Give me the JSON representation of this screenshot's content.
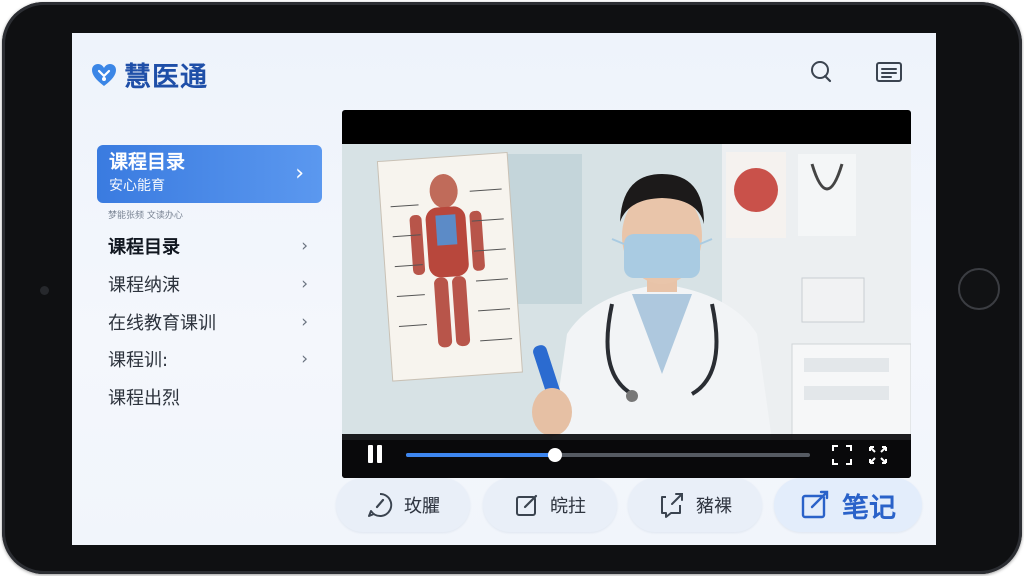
{
  "app": {
    "name": "慧医通",
    "brand_color": "#1f4fa8",
    "accent_color": "#3d86f0"
  },
  "header": {
    "search_icon": "search-icon",
    "menu_icon": "menu-icon"
  },
  "sidebar": {
    "active": {
      "title": "课程目录",
      "subtitle": "安心能育"
    },
    "hint": "梦能张频 文读办心",
    "items": [
      {
        "label": "课程目录",
        "bold": true,
        "chevron": true
      },
      {
        "label": "课程纳涑",
        "chevron": true
      },
      {
        "label": "在线教育课训",
        "chevron": true
      },
      {
        "label": "课程训:",
        "chevron": true
      },
      {
        "label": "课程出烈",
        "chevron": false
      }
    ]
  },
  "video": {
    "state": "playing",
    "progress": 0.37
  },
  "actions": [
    {
      "label": "玫臞",
      "icon": "comment-icon"
    },
    {
      "label": "皖拄",
      "icon": "edit-icon"
    },
    {
      "label": "豬裸",
      "icon": "share-icon"
    },
    {
      "label": "笔记",
      "icon": "note-icon",
      "primary": true
    }
  ]
}
